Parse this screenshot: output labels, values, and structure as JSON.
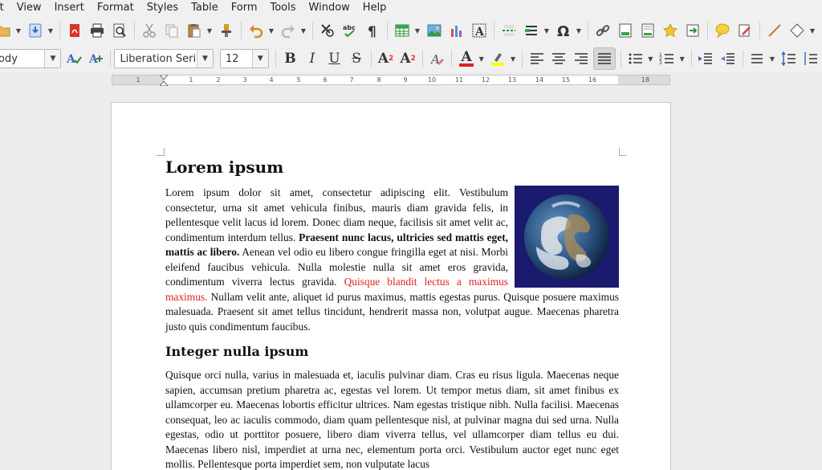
{
  "menu": [
    "it",
    "View",
    "Insert",
    "Format",
    "Styles",
    "Table",
    "Form",
    "Tools",
    "Window",
    "Help"
  ],
  "toolbar2": {
    "paragraph_style": "ody",
    "font_name": "Liberation Seri",
    "font_size": "12",
    "bold": "B",
    "italic": "I",
    "underline": "U",
    "strike": "S",
    "superscript": "A",
    "subscript": "A",
    "font_color": "A"
  },
  "ruler": {
    "numbers": [
      "1",
      "1",
      "2",
      "3",
      "4",
      "5",
      "6",
      "7",
      "8",
      "9",
      "10",
      "11",
      "12",
      "13",
      "14",
      "15",
      "16",
      "18"
    ]
  },
  "document": {
    "heading1": "Lorem ipsum",
    "para1_a": "Lorem ipsum dolor sit amet, consectetur adipiscing elit. Vestibulum consectetur, urna sit amet vehicula finibus, mauris diam gravida felis, in pellentesque velit lacus id lorem. Donec diam neque, facilisis sit amet velit ac, condimentum interdum tellus. ",
    "para1_bold": "Praesent nunc lacus, ultricies sed mattis eget, mattis ac libero.",
    "para1_b": " Aenean vel odio eu libero congue fringilla eget at nisi. Morbi eleifend faucibus vehicula. Nulla molestie nulla sit amet eros gravida, condimentum viverra lectus gravida. ",
    "para1_red": "Quisque blandit lectus a maximus maximus.",
    "para1_c": " Nullam velit ante, aliquet id purus maximus, mattis egestas purus. Quisque posuere maximus malesuada. Praesent sit amet tellus tincidunt, hendrerit massa non, volutpat augue. Maecenas pharetra justo quis condimentum faucibus.",
    "heading2": "Integer nulla ipsum",
    "para2": "Quisque orci nulla, varius in malesuada et, iaculis pulvinar diam. Cras eu risus ligula. Maecenas neque sapien, accumsan pretium pharetra ac, egestas vel lorem. Ut tempor metus diam, sit amet finibus ex ullamcorper eu. Maecenas lobortis efficitur ultrices. Nam egestas tristique nibh. Nulla facilisi. Maecenas consequat, leo ac iaculis commodo, diam quam pellentesque nisl, at pulvinar magna dui sed urna. Nulla egestas, odio ut porttitor posuere, libero diam viverra tellus, vel ullamcorper diam tellus eu dui. Maecenas libero nisl, imperdiet at urna nec, elementum porta orci. Vestibulum auctor eget nunc eget mollis. Pellentesque porta imperdiet sem, non vulputate lacus"
  },
  "colors": {
    "accent_red": "#e02020",
    "highlight_yellow": "#ffff00",
    "earth_bg": "#1a1a6e"
  }
}
